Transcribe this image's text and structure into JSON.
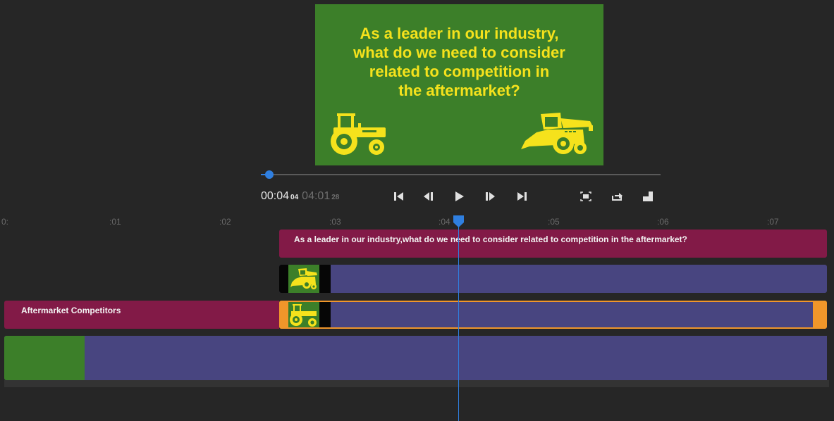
{
  "preview": {
    "caption_lines": [
      "As a leader in our industry,",
      "what do we need to consider",
      "related to competition in",
      "the aftermarket?"
    ],
    "background_color": "#3c7f29",
    "text_color": "#f5e21c",
    "illustrations": [
      "tractor-icon",
      "combine-harvester-icon"
    ]
  },
  "transport": {
    "current_time": "00:04",
    "current_frames": "04",
    "duration": "04:01",
    "duration_frames": "28",
    "buttons": [
      "skip-to-start",
      "step-back",
      "play",
      "step-forward",
      "skip-to-end",
      "fit-screen",
      "loop",
      "export"
    ]
  },
  "ruler": {
    "labels": [
      ":00",
      ":01",
      ":02",
      ":03",
      ":04",
      ":05",
      ":06",
      ":07"
    ]
  },
  "tracks": {
    "caption_clip_text": "As a leader in our industry,what do we need to consider related to competition in the aftermarket?",
    "title_clip_text": "Aftermarket Competitors"
  },
  "colors": {
    "accent": "#2f7fe0",
    "title_clip": "#821a47",
    "media_clip": "#484580",
    "selected_border": "#f0962a",
    "slide_green": "#3c7f29"
  }
}
